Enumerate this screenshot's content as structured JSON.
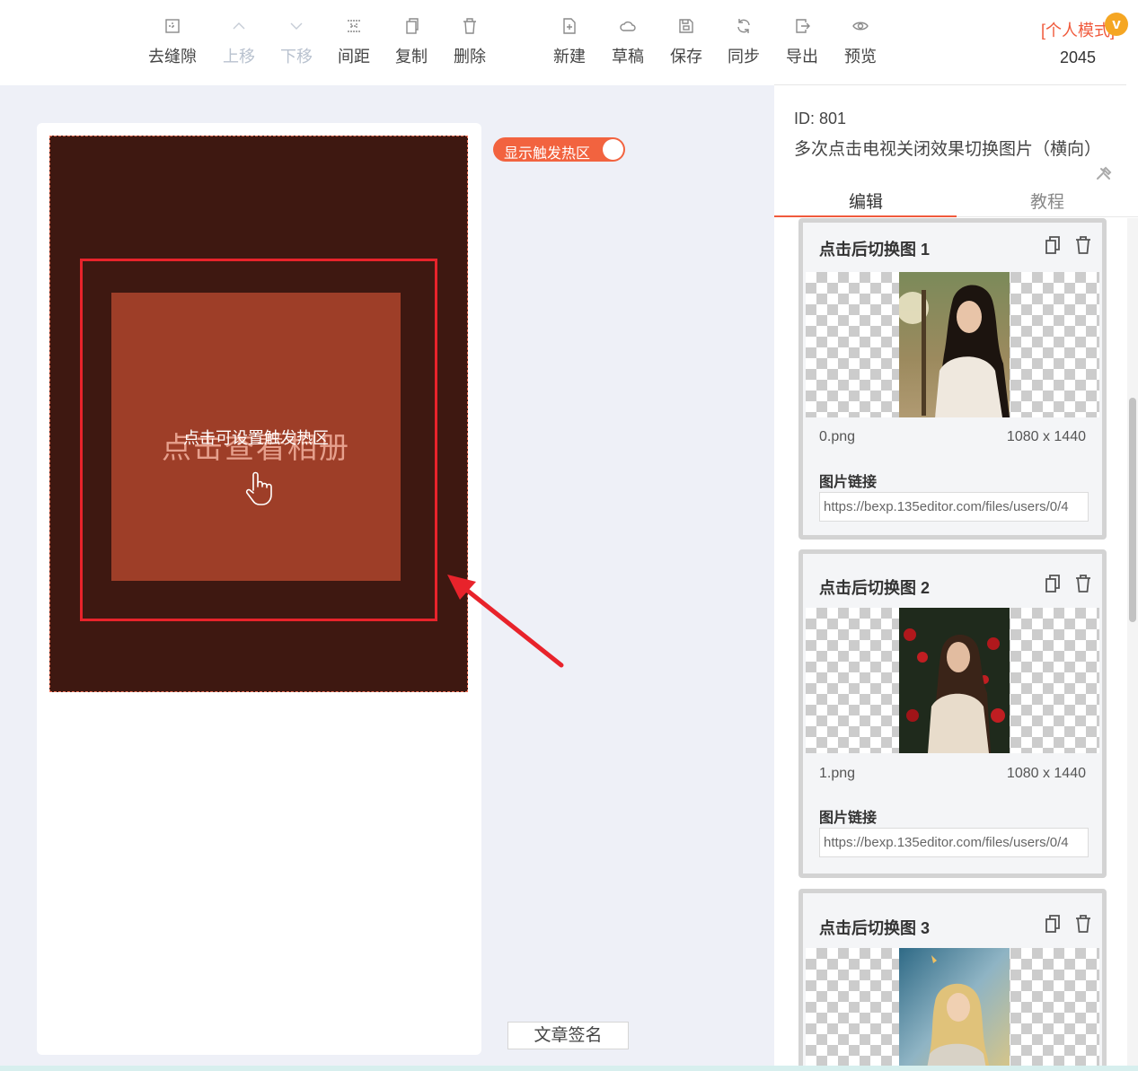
{
  "toolbar": {
    "items": [
      {
        "label": "去缝隙",
        "icon": "gap-remove-icon",
        "disabled": false
      },
      {
        "label": "上移",
        "icon": "move-up-icon",
        "disabled": true
      },
      {
        "label": "下移",
        "icon": "move-down-icon",
        "disabled": true
      },
      {
        "label": "间距",
        "icon": "spacing-icon",
        "disabled": false
      },
      {
        "label": "复制",
        "icon": "copy-icon",
        "disabled": false
      },
      {
        "label": "删除",
        "icon": "trash-icon",
        "disabled": false
      },
      {
        "label": "新建",
        "icon": "new-file-icon",
        "disabled": false
      },
      {
        "label": "草稿",
        "icon": "cloud-icon",
        "disabled": false
      },
      {
        "label": "保存",
        "icon": "save-icon",
        "disabled": false
      },
      {
        "label": "同步",
        "icon": "sync-icon",
        "disabled": false
      },
      {
        "label": "导出",
        "icon": "export-icon",
        "disabled": false
      },
      {
        "label": "预览",
        "icon": "eye-icon",
        "disabled": false
      }
    ],
    "mode_label": "[个人模式]",
    "vip_badge": "v",
    "mode_number": "2045"
  },
  "canvas": {
    "big_text": "点击查看相册",
    "hint_text": "点击可设置触发热区",
    "hot_zone_color": "#3e1811",
    "inner_color": "#9e3e28"
  },
  "toggle": {
    "label": "显示触发热区",
    "on": true
  },
  "sign_button": "文章签名",
  "panel": {
    "id_text": "ID: 801",
    "title": "多次点击电视关闭效果切换图片（横向）",
    "tabs": [
      {
        "label": "编辑",
        "active": true
      },
      {
        "label": "教程",
        "active": false
      }
    ],
    "cards": [
      {
        "title": "点击后切换图 1",
        "file": "0.png",
        "dims": "1080 x 1440",
        "link_label": "图片链接",
        "link": "https://bexp.135editor.com/files/users/0/4"
      },
      {
        "title": "点击后切换图 2",
        "file": "1.png",
        "dims": "1080 x 1440",
        "link_label": "图片链接",
        "link": "https://bexp.135editor.com/files/users/0/4"
      },
      {
        "title": "点击后切换图 3",
        "file": "",
        "dims": "",
        "link_label": "",
        "link": ""
      }
    ]
  },
  "colors": {
    "accent": "#f05a3c",
    "frame_red": "#e8232b"
  }
}
